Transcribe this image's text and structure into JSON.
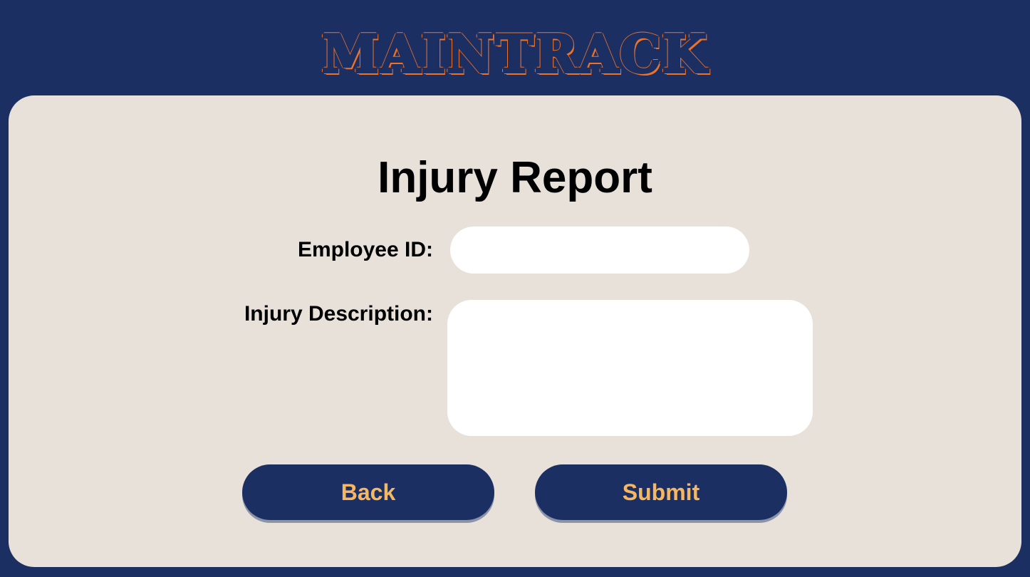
{
  "app": {
    "logo_text": "MAINTRACK"
  },
  "form": {
    "title": "Injury Report",
    "employee_id": {
      "label": "Employee ID:",
      "value": "",
      "placeholder": ""
    },
    "injury_description": {
      "label": "Injury Description:",
      "value": "",
      "placeholder": ""
    }
  },
  "actions": {
    "back_label": "Back",
    "submit_label": "Submit"
  },
  "colors": {
    "background": "#1b2f63",
    "card": "#e8e1da",
    "logo_accent": "#f07227",
    "button_bg": "#1b2f63",
    "button_text": "#f6b765"
  }
}
